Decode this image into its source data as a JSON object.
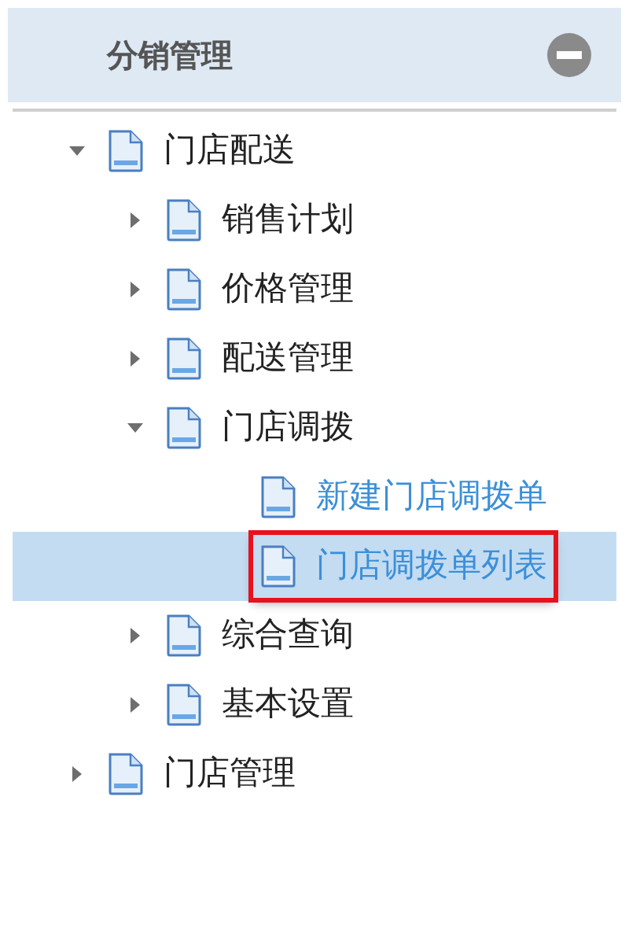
{
  "panel": {
    "title": "分销管理",
    "collapsed": false
  },
  "tree": [
    {
      "label": "门店配送",
      "expanded": true,
      "selected": false,
      "children": [
        {
          "label": "销售计划",
          "expanded": false,
          "selected": false
        },
        {
          "label": "价格管理",
          "expanded": false,
          "selected": false
        },
        {
          "label": "配送管理",
          "expanded": false,
          "selected": false
        },
        {
          "label": "门店调拨",
          "expanded": true,
          "selected": false,
          "children": [
            {
              "label": "新建门店调拨单",
              "selected": false
            },
            {
              "label": "门店调拨单列表",
              "selected": true
            }
          ]
        },
        {
          "label": "综合查询",
          "expanded": false,
          "selected": false
        },
        {
          "label": "基本设置",
          "expanded": false,
          "selected": false
        }
      ]
    },
    {
      "label": "门店管理",
      "expanded": false,
      "selected": false
    }
  ]
}
